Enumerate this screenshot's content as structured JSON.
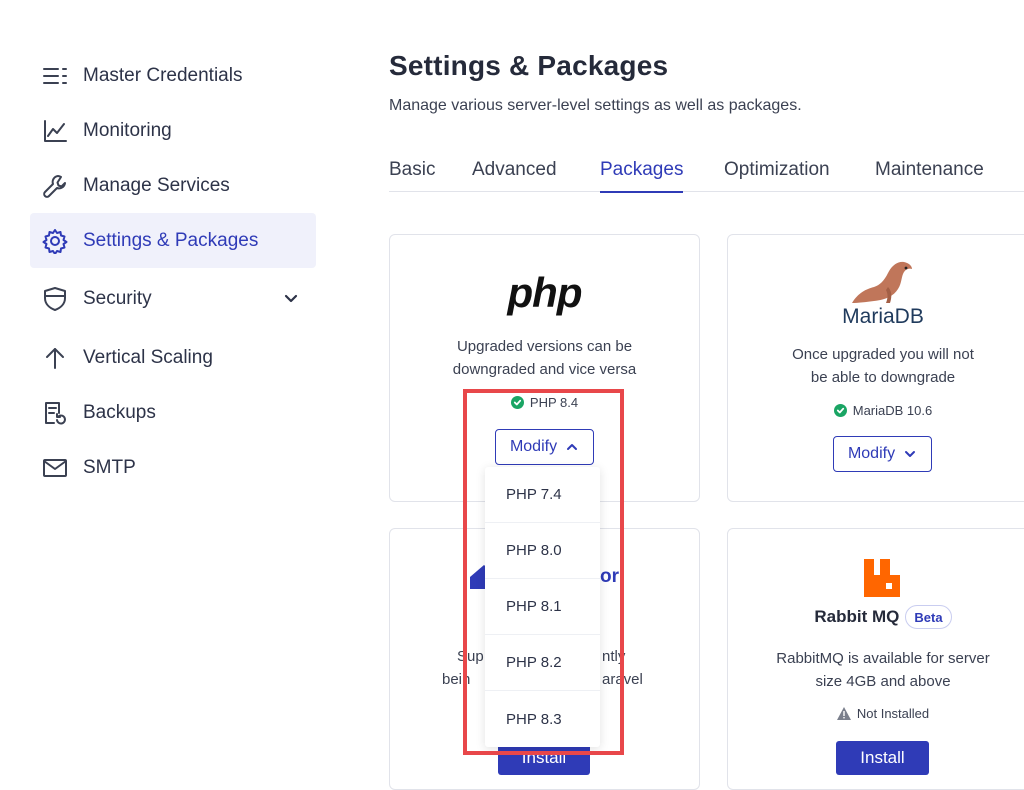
{
  "sidebar": {
    "items": [
      {
        "label": "Master Credentials",
        "icon": "list-icon"
      },
      {
        "label": "Monitoring",
        "icon": "chart-line-icon"
      },
      {
        "label": "Manage Services",
        "icon": "wrench-icon"
      },
      {
        "label": "Settings & Packages",
        "icon": "gear-icon",
        "active": true
      },
      {
        "label": "Security",
        "icon": "shield-icon"
      },
      {
        "label": "Vertical Scaling",
        "icon": "arrow-up-icon"
      },
      {
        "label": "Backups",
        "icon": "backup-icon"
      },
      {
        "label": "SMTP",
        "icon": "mail-icon"
      }
    ]
  },
  "header": {
    "title": "Settings & Packages",
    "subtitle": "Manage various server-level settings as well as packages."
  },
  "tabs": [
    "Basic",
    "Advanced",
    "Packages",
    "Optimization",
    "Maintenance"
  ],
  "active_tab": "Packages",
  "cards": {
    "php": {
      "logo_text": "php",
      "desc_line1": "Upgraded versions can be",
      "desc_line2": "downgraded and vice versa",
      "status": "PHP 8.4",
      "button": "Modify"
    },
    "mariadb": {
      "logo_text": "MariaDB",
      "desc_line1": "Once upgraded you will not",
      "desc_line2": "be able to downgrade",
      "status": "MariaDB 10.6",
      "button": "Modify"
    },
    "supervisor": {
      "title_fragment": "or",
      "desc_fragment1a": "Sup",
      "desc_fragment1b": "ntly",
      "desc_fragment2a": "bein",
      "desc_fragment2b": "aravel",
      "button": "Install"
    },
    "rabbitmq": {
      "title": "Rabbit MQ",
      "badge": "Beta",
      "desc_line1": "RabbitMQ is available for server",
      "desc_line2": "size 4GB and above",
      "status": "Not Installed",
      "button": "Install"
    }
  },
  "dropdown": {
    "options": [
      "PHP 7.4",
      "PHP 8.0",
      "PHP 8.1",
      "PHP 8.2",
      "PHP 8.3"
    ]
  },
  "colors": {
    "accent": "#2f3bb7",
    "success": "#1aa564",
    "highlight": "#e8474a",
    "rabbit": "#ff6600"
  }
}
